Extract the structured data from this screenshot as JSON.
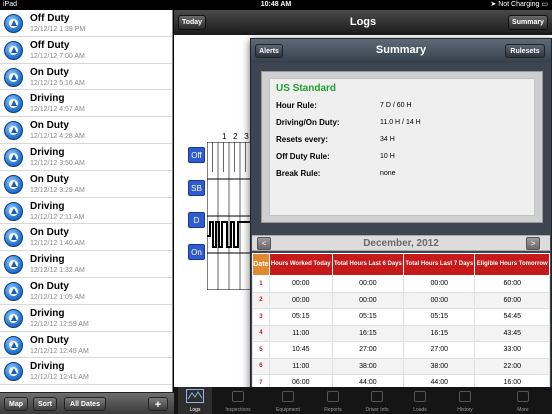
{
  "status": {
    "device": "iPad",
    "time": "10:48 AM",
    "charging": "Not Charging"
  },
  "logs_list": [
    {
      "status": "Off Duty",
      "date": "12/12/12 1:39 PM"
    },
    {
      "status": "Off Duty",
      "date": "12/12/12 7:00 AM"
    },
    {
      "status": "On Duty",
      "date": "12/12/12 5:16 AM"
    },
    {
      "status": "Driving",
      "date": "12/12/12 4:57 AM"
    },
    {
      "status": "On Duty",
      "date": "12/12/12 4:28 AM"
    },
    {
      "status": "Driving",
      "date": "12/12/12 3:50 AM"
    },
    {
      "status": "On Duty",
      "date": "12/12/12 3:29 AM"
    },
    {
      "status": "Driving",
      "date": "12/12/12 2:11 AM"
    },
    {
      "status": "On Duty",
      "date": "12/12/12 1:40 AM"
    },
    {
      "status": "Driving",
      "date": "12/12/12 1:32 AM"
    },
    {
      "status": "On Duty",
      "date": "12/12/12 1:05 AM"
    },
    {
      "status": "Driving",
      "date": "12/12/12 12:59 AM"
    },
    {
      "status": "On Duty",
      "date": "12/12/12 12:45 AM"
    },
    {
      "status": "Driving",
      "date": "12/12/12 12:41 AM"
    }
  ],
  "left_toolbar": {
    "map": "Map",
    "sort": "Sort",
    "all_dates": "All Dates",
    "add": "+"
  },
  "nav": {
    "today": "Today",
    "title": "Logs",
    "summary": "Summary"
  },
  "status_buttons": {
    "off": "Off",
    "sb": "SB",
    "d": "D",
    "on": "On"
  },
  "grid_hours": [
    "1",
    "2",
    "3"
  ],
  "summary": {
    "alerts": "Alerts",
    "title": "Summary",
    "rulesets": "Rulesets",
    "rule_name": "US Standard",
    "hour_rule_label": "Hour Rule:",
    "hour_rule_value": "7 D / 60 H",
    "driving_label": "Driving/On Duty:",
    "driving_value": "11.0 H / 14 H",
    "resets_label": "Resets every:",
    "resets_value": "34 H",
    "offduty_label": "Off Duty Rule:",
    "offduty_value": "10 H",
    "break_label": "Break Rule:",
    "break_value": "none",
    "month": "December, 2012",
    "prev": "<",
    "next": ">",
    "table": {
      "headers": [
        "Date",
        "Hours Worked Today",
        "Total Hours Last 6 Days",
        "Total Hours Last 7 Days",
        "Eligible Hours Tomorrow"
      ],
      "rows": [
        [
          "1",
          "00:00",
          "00:00",
          "00:00",
          "60:00"
        ],
        [
          "2",
          "00:00",
          "00:00",
          "00:00",
          "60:00"
        ],
        [
          "3",
          "05:15",
          "05:15",
          "05:15",
          "54:45"
        ],
        [
          "4",
          "11:00",
          "16:15",
          "16:15",
          "43:45"
        ],
        [
          "5",
          "10:45",
          "27:00",
          "27:00",
          "33:00"
        ],
        [
          "6",
          "11:00",
          "38:00",
          "38:00",
          "22:00"
        ],
        [
          "7",
          "06:00",
          "44:00",
          "44:00",
          "16:00"
        ],
        [
          "8",
          "00:00",
          "44:00",
          "44:00",
          "16:00"
        ]
      ]
    }
  },
  "tabs": [
    "Logs",
    "Inspections",
    "Equipment",
    "Reports",
    "Driver Info",
    "Loads",
    "History",
    "More"
  ]
}
